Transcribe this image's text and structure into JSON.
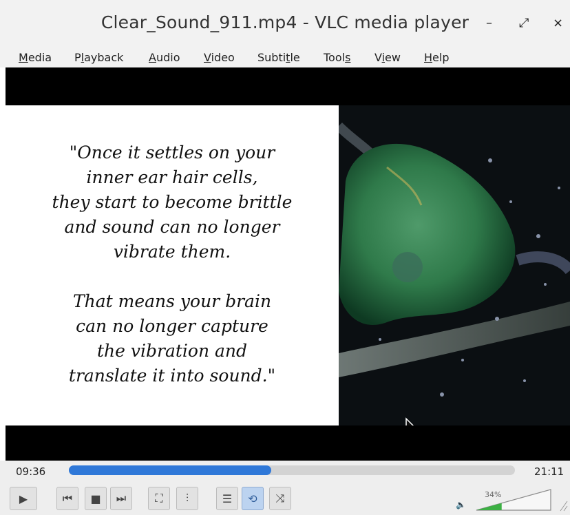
{
  "window": {
    "title": "Clear_Sound_911.mp4 - VLC media player",
    "controls": {
      "minimize": "–",
      "maximize": "⤢",
      "close": "×"
    }
  },
  "menu": {
    "items": [
      {
        "pre": "",
        "ul": "M",
        "post": "edia"
      },
      {
        "pre": "P",
        "ul": "l",
        "post": "ayback"
      },
      {
        "pre": "",
        "ul": "A",
        "post": "udio"
      },
      {
        "pre": "",
        "ul": "V",
        "post": "ideo"
      },
      {
        "pre": "Subti",
        "ul": "t",
        "post": "le"
      },
      {
        "pre": "Tool",
        "ul": "s",
        "post": ""
      },
      {
        "pre": "V",
        "ul": "i",
        "post": "ew"
      },
      {
        "pre": "",
        "ul": "H",
        "post": "elp"
      }
    ]
  },
  "video": {
    "quote": "\"Once it settles on your\ninner ear hair cells,\nthey start to become brittle\nand sound can no longer\nvibrate them.\n\nThat means your brain\ncan no longer capture\nthe vibration and\ntranslate it into sound.\""
  },
  "playback": {
    "elapsed": "09:36",
    "total": "21:11",
    "progress": 0.453
  },
  "volume": {
    "label": "34%",
    "level": 0.34
  },
  "icons": {
    "play": "▶",
    "prev": "⏮",
    "stop": "■",
    "next": "⏭",
    "fullscreen": "⛶",
    "extended": "⫶",
    "playlist": "☰",
    "loop": "⟲",
    "shuffle": "⤨",
    "speaker": "🔈"
  },
  "colors": {
    "accent": "#2f78d8",
    "volume_fill": "#3cb043"
  }
}
